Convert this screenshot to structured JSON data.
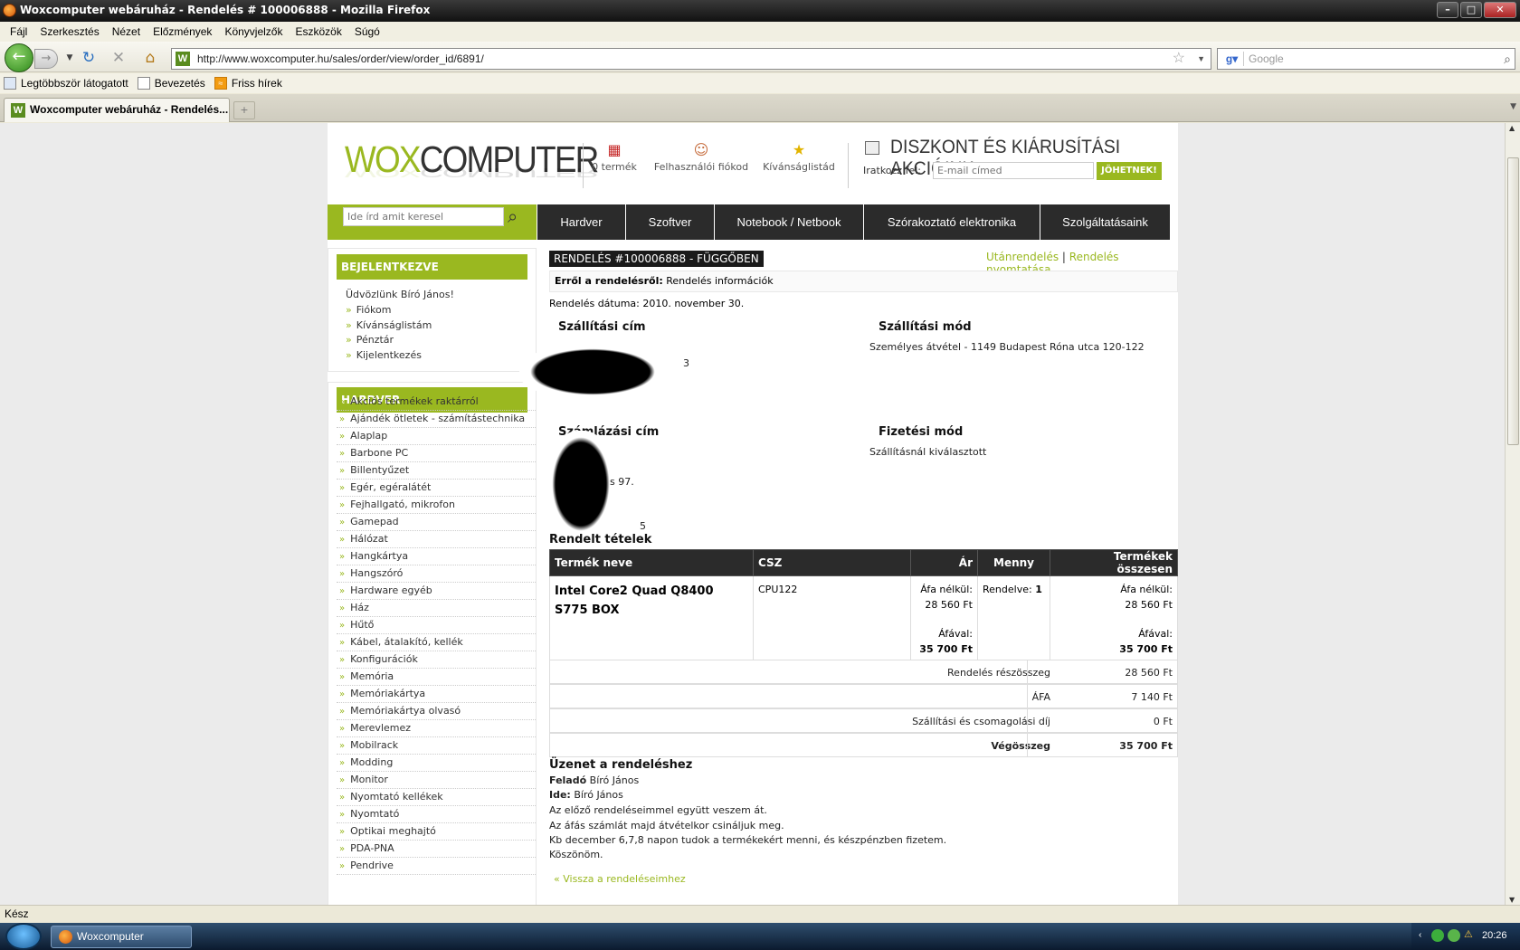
{
  "window": {
    "title": "Woxcomputer webáruház - Rendelés # 100006888 - Mozilla Firefox"
  },
  "menu": [
    "Fájl",
    "Szerkesztés",
    "Nézet",
    "Előzmények",
    "Könyvjelzők",
    "Eszközök",
    "Súgó"
  ],
  "nav": {
    "url": "http://www.woxcomputer.hu/sales/order/view/order_id/6891/",
    "search_placeholder": "Google"
  },
  "bookmarks": [
    "Legtöbbször látogatott",
    "Bevezetés",
    "Friss hírek"
  ],
  "tab": {
    "label": "Woxcomputer webáruház - Rendelés..."
  },
  "header": {
    "logo_wox": "WOX",
    "logo_computer": "COMPUTER",
    "cart": "0 termék",
    "account": "Felhasználói fiókod",
    "wishlist": "Kívánságlistád",
    "promo": "DISZKONT ÉS KIÁRUSÍTÁSI AKCIÓINK",
    "newsletter_label": "Iratkozz fel:",
    "newsletter_placeholder": "E-mail címed",
    "newsletter_button": "JÖHETNEK!",
    "search_placeholder": "Ide írd amit keresel"
  },
  "topnav": [
    "Hardver",
    "Szoftver",
    "Notebook / Netbook",
    "Szórakoztató elektronika",
    "Szolgáltatásaink"
  ],
  "login_box": {
    "title": "BEJELENTKEZVE",
    "welcome": "Üdvözlünk Bíró János!",
    "links": [
      "Fiókom",
      "Kívánságlistám",
      "Pénztár",
      "Kijelentkezés"
    ]
  },
  "categories": {
    "title": "HARDVER",
    "items": [
      "Akciós termékek raktárról",
      "Ajándék ötletek - számítástechnika",
      "Alaplap",
      "Barbone PC",
      "Billentyűzet",
      "Egér, egéralátét",
      "Fejhallgató, mikrofon",
      "Gamepad",
      "Hálózat",
      "Hangkártya",
      "Hangszóró",
      "Hardware egyéb",
      "Ház",
      "Hűtő",
      "Kábel, átalakító, kellék",
      "Konfigurációk",
      "Memória",
      "Memóriakártya",
      "Memóriakártya olvasó",
      "Merevlemez",
      "Mobilrack",
      "Modding",
      "Monitor",
      "Nyomtató kellékek",
      "Nyomtató",
      "Optikai meghajtó",
      "PDA-PNA",
      "Pendrive"
    ]
  },
  "order": {
    "title": "RENDELÉS #100006888 - FÜGGŐBEN",
    "reorder": "Utánrendelés",
    "link_sep": "|",
    "print": "Rendelés nyomtatása",
    "about_label": "Erről a rendelésről:",
    "about_value": "Rendelés információk",
    "date": "Rendelés dátuma: 2010. november 30.",
    "shipping_address_title": "Szállítási cím",
    "shipping_method_title": "Szállítási mód",
    "shipping_method": "Személyes átvétel - 1149 Budapest Róna utca 120-122",
    "billing_address_title": "Számlázási cím",
    "payment_method_title": "Fizetési mód",
    "payment_method": "Szállításnál kiválasztott",
    "frag_a": "3",
    "frag_b": "s 97.",
    "frag_c": "5",
    "items_title": "Rendelt tételek",
    "columns": [
      "Termék neve",
      "CSZ",
      "Ár",
      "Menny",
      "Termékek összesen"
    ],
    "item": {
      "name": "Intel Core2 Quad Q8400 S775 BOX",
      "sku": "CPU122",
      "net_label": "Áfa nélkül:",
      "net_price": "28 560 Ft",
      "gross_label": "Áfával:",
      "gross_price": "35 700 Ft",
      "qty_label": "Rendelve:",
      "qty": "1",
      "total_net": "28 560 Ft",
      "total_gross": "35 700 Ft"
    },
    "totals": [
      {
        "label": "Rendelés részösszeg",
        "value": "28 560 Ft"
      },
      {
        "label": "ÁFA",
        "value": "7 140 Ft"
      },
      {
        "label": "Szállítási és csomagolási díj",
        "value": "0 Ft"
      },
      {
        "label": "Végösszeg",
        "value": "35 700 Ft"
      }
    ],
    "message_title": "Üzenet a rendeléshez",
    "from_label": "Feladó",
    "from": "Bíró János",
    "to_label": "Ide:",
    "to": "Bíró János",
    "message_lines": [
      "Az előző rendeléseimmel együtt veszem át.",
      "Az áfás számlát majd átvételkor csináljuk meg.",
      "Kb december 6,7,8 napon tudok a termékekért menni, és készpénzben fizetem.",
      "Köszönöm."
    ],
    "back": "« Vissza a rendeléseimhez"
  },
  "status": "Kész",
  "taskbar": {
    "window": "Woxcomputer webáru...",
    "clock": "20:26"
  }
}
